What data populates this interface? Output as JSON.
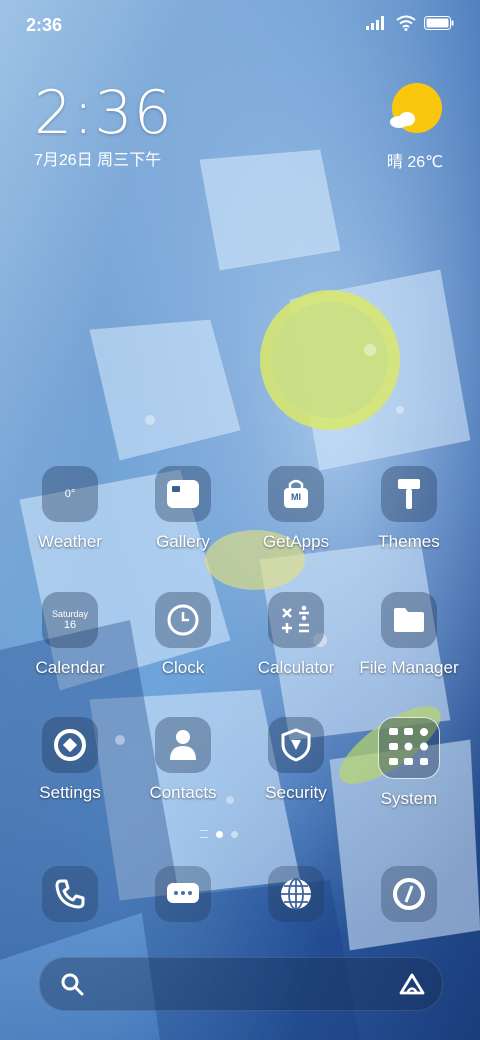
{
  "status_bar": {
    "time": "2:36",
    "icons": [
      "signal-icon",
      "wifi-icon",
      "battery-icon"
    ]
  },
  "clock_widget": {
    "time": "2:36",
    "date": "7月26日 周三下午"
  },
  "weather_widget": {
    "text": "晴 26℃",
    "icon": "sun-cloud-icon"
  },
  "apps": [
    {
      "label": "Weather",
      "icon": "weather-icon",
      "icon_text": "0°"
    },
    {
      "label": "Gallery",
      "icon": "gallery-icon"
    },
    {
      "label": "GetApps",
      "icon": "getapps-icon",
      "icon_text": "MI"
    },
    {
      "label": "Themes",
      "icon": "themes-icon"
    },
    {
      "label": "Calendar",
      "icon": "calendar-icon",
      "icon_day": "Saturday",
      "icon_date": "16"
    },
    {
      "label": "Clock",
      "icon": "clock-icon"
    },
    {
      "label": "Calculator",
      "icon": "calculator-icon"
    },
    {
      "label": "File Manager",
      "icon": "folder-icon"
    },
    {
      "label": "Settings",
      "icon": "settings-icon"
    },
    {
      "label": "Contacts",
      "icon": "contacts-icon"
    },
    {
      "label": "Security",
      "icon": "security-icon"
    },
    {
      "label": "System",
      "icon": "system-folder-icon"
    }
  ],
  "page_indicator": {
    "pages": 2,
    "current": 1
  },
  "dock": [
    "phone-icon",
    "messages-icon",
    "browser-icon",
    "camera-icon"
  ],
  "search_bar": {
    "left_icon": "search-icon",
    "right_icon": "assistant-icon"
  },
  "colors": {
    "sun": "#f9c80e",
    "accent": "#ffffff"
  }
}
